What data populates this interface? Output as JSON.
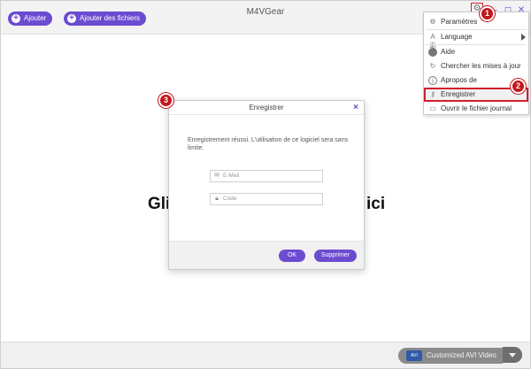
{
  "toolbar": {
    "add_label": "Ajouter",
    "add_files_label": "Ajouter des fichiers",
    "app_title": "M4VGear"
  },
  "window_controls": [
    "gear-icon",
    "minimize-icon",
    "maximize-icon",
    "close-icon"
  ],
  "menu": {
    "items": [
      {
        "label": "Paramètres",
        "icon": "gear-icon"
      },
      {
        "label": "Language",
        "icon": "language-icon",
        "has_submenu": true
      },
      {
        "label": "Aide",
        "icon": "help-icon"
      },
      {
        "label": "Chercher les mises à jour",
        "icon": "refresh-icon"
      },
      {
        "label": "Apropos de",
        "icon": "info-icon"
      },
      {
        "label": "Enregistrer",
        "icon": "key-icon",
        "highlighted": true
      },
      {
        "label": "Ouvrir le fichier journal",
        "icon": "document-icon"
      }
    ]
  },
  "badges": [
    "1",
    "2",
    "3"
  ],
  "background": {
    "heading_left": "Gli",
    "heading_right": "ici"
  },
  "dialog": {
    "title": "Enregistrer",
    "message": "Enregistrement réussi. L'utilisation de ce logiciel sera sans limite.",
    "email_placeholder": "E-Mail",
    "code_placeholder": "Code",
    "ok_label": "OK",
    "delete_label": "Supprimer"
  },
  "bottombar": {
    "format_label": "Customized AVI Video",
    "format_icon_text": "AVI"
  },
  "colors": {
    "accent": "#6b4cd0",
    "badge_red": "#c4161c",
    "highlight_border": "#d21f2e"
  }
}
